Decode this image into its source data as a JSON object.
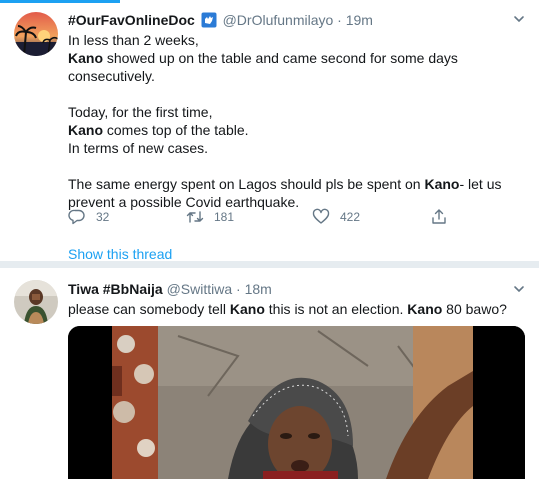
{
  "tweets": [
    {
      "display_name": "#OurFavOnlineDoc",
      "handle": "@DrOlufunmilayo",
      "separator": "·",
      "time": "19m",
      "paragraphs": [
        [
          {
            "text": "In less than 2 weeks,",
            "bold": false
          },
          {
            "text": "\n",
            "bold": false
          },
          {
            "text": "Kano",
            "bold": true
          },
          {
            "text": " showed up on the table and came second for some days consecutively.",
            "bold": false
          }
        ],
        [
          {
            "text": "Today, for the first time,",
            "bold": false
          },
          {
            "text": "\n",
            "bold": false
          },
          {
            "text": "Kano",
            "bold": true
          },
          {
            "text": " comes top of the table.",
            "bold": false
          },
          {
            "text": "\n",
            "bold": false
          },
          {
            "text": "In terms of new cases.",
            "bold": false
          }
        ],
        [
          {
            "text": "The same energy spent on Lagos should pls be spent on ",
            "bold": false
          },
          {
            "text": "Kano",
            "bold": true
          },
          {
            "text": "- let us prevent a possible Covid earthquake.",
            "bold": false
          }
        ]
      ],
      "reply_count": "32",
      "retweet_count": "181",
      "like_count": "422",
      "show_thread": "Show this thread"
    },
    {
      "display_name": "Tiwa #BbNaija",
      "handle": "@Swittiwa",
      "separator": "·",
      "time": "18m",
      "paragraphs": [
        [
          {
            "text": "please can somebody tell ",
            "bold": false
          },
          {
            "text": "Kano",
            "bold": true
          },
          {
            "text": " this is not an election. ",
            "bold": false
          },
          {
            "text": "Kano",
            "bold": true
          },
          {
            "text": " 80 bawo?",
            "bold": false
          }
        ]
      ]
    }
  ],
  "icons": {
    "caret": "chevron-down-icon",
    "reply": "reply-icon",
    "retweet": "retweet-icon",
    "like": "heart-icon",
    "share": "share-icon",
    "badge": "sign-language-badge-icon"
  },
  "colors": {
    "accent": "#1da1f2",
    "secondary_text": "#657786",
    "divider": "#e6ecf0"
  }
}
